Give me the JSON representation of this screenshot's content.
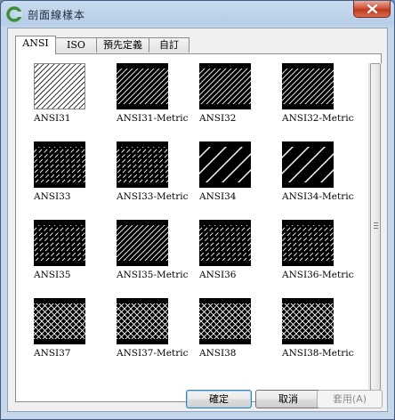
{
  "window": {
    "title": "剖面線樣本"
  },
  "tabs": [
    {
      "label": "ANSI",
      "active": true
    },
    {
      "label": "ISO",
      "active": false
    },
    {
      "label": "預先定義",
      "active": false
    },
    {
      "label": "自訂",
      "active": false
    }
  ],
  "patterns": [
    {
      "name": "ANSI31",
      "style": "outline"
    },
    {
      "name": "ANSI31-Metric",
      "style": "lines"
    },
    {
      "name": "ANSI32",
      "style": "lines"
    },
    {
      "name": "ANSI32-Metric",
      "style": "lines"
    },
    {
      "name": "ANSI33",
      "style": "dashes"
    },
    {
      "name": "ANSI33-Metric",
      "style": "dashes"
    },
    {
      "name": "ANSI34",
      "style": "bands"
    },
    {
      "name": "ANSI34-Metric",
      "style": "bands"
    },
    {
      "name": "ANSI35",
      "style": "dashes"
    },
    {
      "name": "ANSI35-Metric",
      "style": "lines"
    },
    {
      "name": "ANSI36",
      "style": "dashes"
    },
    {
      "name": "ANSI36-Metric",
      "style": "dashes"
    },
    {
      "name": "ANSI37",
      "style": "cross"
    },
    {
      "name": "ANSI37-Metric",
      "style": "cross"
    },
    {
      "name": "ANSI38",
      "style": "cross"
    },
    {
      "name": "ANSI38-Metric",
      "style": "cross"
    }
  ],
  "buttons": {
    "ok": "確定",
    "cancel": "取消",
    "apply": "套用(A)"
  },
  "icons": {
    "app": "autocad-logo-icon",
    "close": "close-icon",
    "grip": "scroll-grip-icon"
  }
}
